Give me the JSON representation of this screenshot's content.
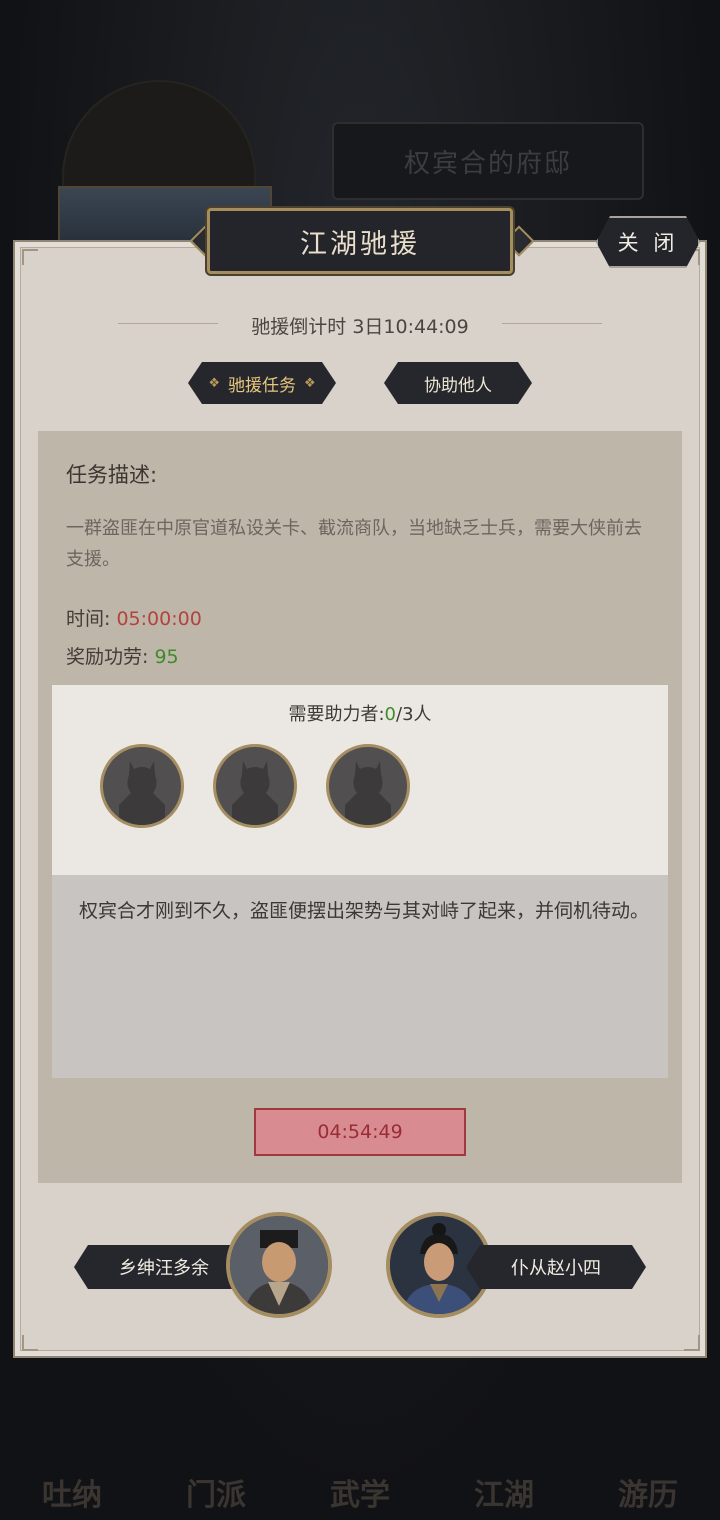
{
  "background": {
    "mansion_title": "权宾合的府邸",
    "nav": [
      "吐纳",
      "门派",
      "武学",
      "江湖",
      "游历"
    ]
  },
  "dialog": {
    "title": "江湖驰援",
    "close_label": "关 闭",
    "countdown_label": "驰援倒计时",
    "countdown_value": "3日10:44:09",
    "tabs": [
      {
        "label": "驰援任务",
        "active": true
      },
      {
        "label": "协助他人",
        "active": false
      }
    ]
  },
  "task": {
    "heading": "任务描述:",
    "description": "一群盗匪在中原官道私设关卡、截流商队，当地缺乏士兵，需要大侠前去支援。",
    "time_label": "时间:",
    "time_value": "05:00:00",
    "reward_label": "奖励功劳:",
    "reward_value": "95",
    "helpers_label": "需要助力者:",
    "helpers_current": "0",
    "helpers_total": "/3人",
    "story": "权宾合才刚到不久，盗匪便摆出架势与其对峙了起来，并伺机待动。",
    "timer": "04:54:49"
  },
  "npcs": [
    {
      "name": "乡绅汪多余"
    },
    {
      "name": "仆从赵小四"
    }
  ],
  "colors": {
    "time_red": "#b2443a",
    "reward_green": "#3f8a2a",
    "gold_border": "#a58e5e",
    "timer_fill": "#d88c91"
  }
}
